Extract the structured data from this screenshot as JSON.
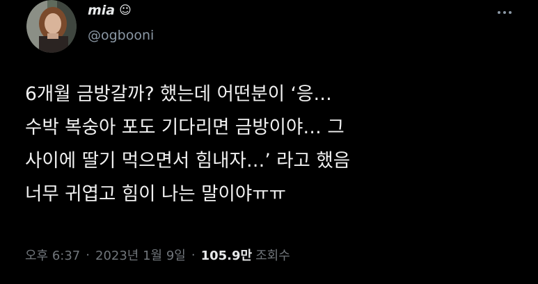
{
  "tweet": {
    "author": {
      "display_name": "mia",
      "name_emoji": "☺",
      "handle": "@ogbooni"
    },
    "body_lines": [
      "6개월 금방갈까? 했는데 어떤분이 ‘응…",
      "수박 복숭아 포도 기다리면 금방이야… 그",
      "사이에 딸기 먹으면서 힘내자…’ 라고 했음",
      "너무 귀엽고 힘이 나는 말이야ㅠㅠ"
    ],
    "meta": {
      "time": "오후 6:37",
      "separator": "·",
      "date": "2023년 1월 9일",
      "views_count": "105.9만",
      "views_label": "조회수"
    },
    "icons": {
      "more": "more-horizontal-icon",
      "name_emoji": "smile-icon"
    },
    "colors": {
      "background": "#000000",
      "primary_text": "#e7e9ea",
      "secondary_text": "#71767b"
    }
  }
}
